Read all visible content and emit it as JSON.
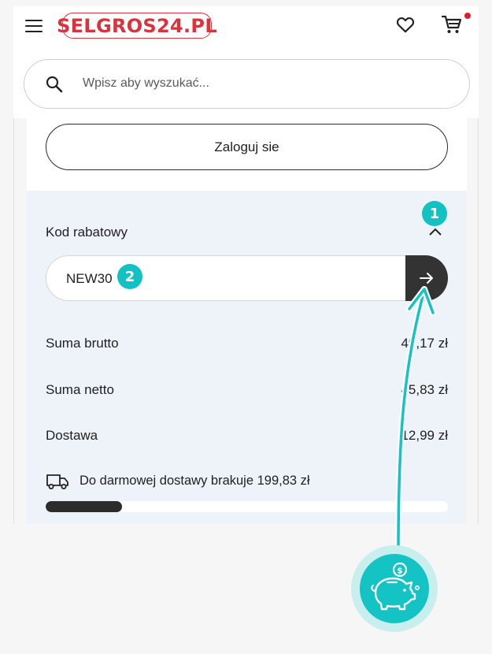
{
  "header": {
    "logo_text": "SELGROS24.PL",
    "search_placeholder": "Wpisz aby wyszukać...",
    "icons": [
      "menu-icon",
      "heart-icon",
      "cart-icon"
    ],
    "cart_has_notification": true
  },
  "panel": {
    "login_label": "Zaloguj sie",
    "discount_label": "Kod rabatowy",
    "discount_code": "NEW30",
    "rows": [
      {
        "label": "Suma brutto",
        "value": "49,17 zł"
      },
      {
        "label": "Suma netto",
        "value": "45,83 zł"
      },
      {
        "label": "Dostawa",
        "value": "12,99 zł"
      }
    ],
    "free_delivery_text": "Do darmowej dostawy brakuje 199,83 zł",
    "free_delivery_progress": 0.19
  },
  "overlay": {
    "badge_1": "1",
    "badge_2": "2",
    "piggy_icon": "piggy-bank-coin-icon"
  },
  "colors": {
    "brand_red": "#d9333d",
    "accent_teal": "#14c3c3",
    "panel_bg": "#eef3fa",
    "button_dark": "#333333"
  }
}
